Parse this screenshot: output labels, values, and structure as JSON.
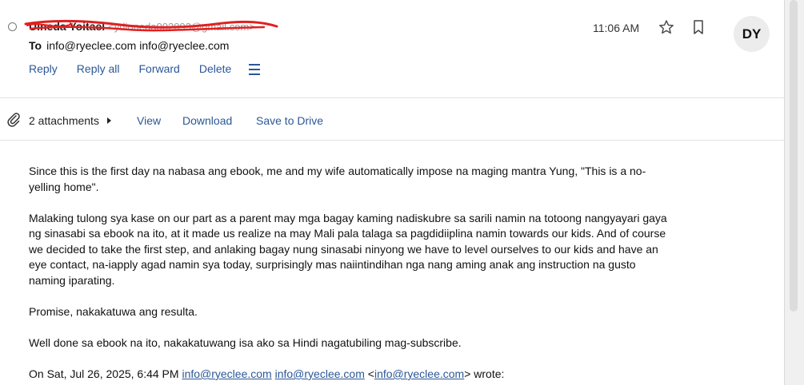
{
  "header": {
    "sender_name": "Ulneda Yoitael",
    "sender_email": "<ydioneda002093@gmail.com>",
    "to_label": "To",
    "to_value": "info@ryeclee.com info@ryeclee.com",
    "time": "11:06 AM",
    "avatar_initials": "DY",
    "actions": {
      "reply": "Reply",
      "reply_all": "Reply all",
      "forward": "Forward",
      "delete": "Delete"
    },
    "icons": [
      "radio-icon",
      "star-icon",
      "bookmark-icon",
      "more-menu-icon"
    ]
  },
  "attachments": {
    "count_label": "2 attachments",
    "view": "View",
    "download": "Download",
    "save_to_drive": "Save to Drive",
    "icons": [
      "paperclip-icon",
      "caret-right-icon"
    ]
  },
  "body": {
    "paragraphs": [
      "Since this is the first day na nabasa ang ebook,  me and my wife automatically impose na maging mantra Yung,  \"This is a no-yelling home\".",
      "Malaking tulong sya kase on our part as a parent may mga bagay kaming nadiskubre sa sarili namin na totoong nangyayari gaya ng sinasabi sa ebook na ito, at it made us realize na may Mali pala talaga sa pagdidiiplina namin towards our kids. And of course we decided to take the first step, and anlaking bagay nung sinasabi ninyong we have to level ourselves to our kids and have an eye contact, na-iapply agad namin sya today, surprisingly mas naiintindihan nga nang aming anak ang instruction na gusto naming iparating.",
      "Promise, nakakatuwa ang resulta.",
      "Well done sa ebook na ito, nakakatuwang isa ako sa Hindi nagatubiling mag-subscribe."
    ],
    "quote": {
      "prefix": "On Sat, Jul 26, 2025, 6:44 PM ",
      "link1": "info@ryeclee.com",
      "link2": "info@ryeclee.com",
      "open_bracket": " <",
      "link3": "info@ryeclee.com",
      "suffix": "> wrote:"
    }
  },
  "colors": {
    "link": "#2b5797",
    "redaction": "#e02020"
  }
}
